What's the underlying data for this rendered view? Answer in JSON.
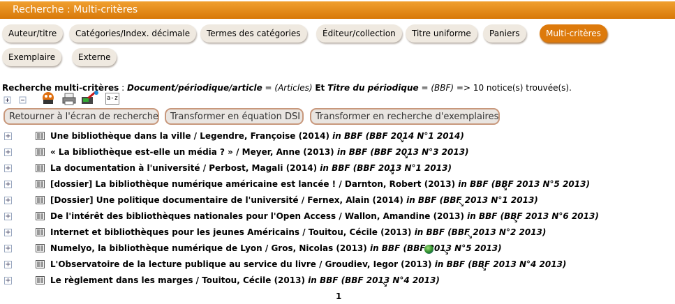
{
  "header": {
    "title": "Recherche : Multi-critères"
  },
  "tabs": [
    {
      "label": "Auteur/titre"
    },
    {
      "label": "Catégories/Index. décimale"
    },
    {
      "label": "Termes des catégories"
    },
    {
      "label": "Éditeur/collection"
    },
    {
      "label": "Titre uniforme"
    },
    {
      "label": "Paniers"
    },
    {
      "label": "Multi-critères",
      "active": true
    },
    {
      "label": "Exemplaire"
    },
    {
      "label": "Externe"
    }
  ],
  "summary": {
    "intro": "Recherche multi-critères",
    "colon": " : ",
    "field1": "Document/périodique/article",
    "eq1": " = (Articles) ",
    "and": "Et",
    "field2": "Titre du périodique",
    "eq2": " = (BBF)",
    "result": " => 10 notice(s) trouvée(s)."
  },
  "toolbar": {
    "sort_label": "a-z"
  },
  "actions": {
    "back": "Retourner à l'écran de recherche",
    "dsi": "Transformer en équation DSI",
    "copies": "Transformer en recherche d'exemplaires"
  },
  "results": [
    {
      "title": "Une bibliothèque dans la ville / Legendre, Françoise (2014)",
      "source": "in BBF (BBF 2014 N°1 2014)"
    },
    {
      "title": "« La bibliothèque est-elle un média ? » / Meyer, Anne (2013)",
      "source": "in BBF (BBF 2013 N°3 2013)"
    },
    {
      "title": "La documentation à l'université / Perbost, Magali (2014)",
      "source": "in BBF (BBF 2013 N°1 2013)"
    },
    {
      "title": "[dossier] La bibliothèque numérique américaine est lancée ! / Darnton, Robert (2013)",
      "source": "in BBF (BBF 2013 N°5 2013)"
    },
    {
      "title": "[Dossier] Une politique documentaire de l'université / Fernex, Alain (2014)",
      "source": "in BBF (BBF 2013 N°1 2013)"
    },
    {
      "title": "De l'intérêt des bibliothèques nationales pour l'Open Access / Wallon, Amandine (2013)",
      "source": "in BBF (BBF 2013 N°6 2013)"
    },
    {
      "title": "Internet et bibliothèques pour les jeunes Américains / Touitou, Cécile (2013)",
      "source": "in BBF (BBF 2013 N°2 2013)"
    },
    {
      "title": "Numelyo, la bibliothèque numérique de Lyon / Gros, Nicolas (2013)",
      "source": "in BBF (BBF 2013 N°5 2013)",
      "globe": true
    },
    {
      "title": "L'Observatoire de la lecture publique au service du livre / Groudiev, Iegor (2013)",
      "source": "in BBF (BBF 2013 N°4 2013)"
    },
    {
      "title": "Le règlement dans les marges / Touitou, Cécile (2013)",
      "source": "in BBF (BBF 2013 N°4 2013)"
    }
  ],
  "pagination": {
    "current": "1"
  },
  "colors": {
    "header": "#e8901c",
    "active_tab": "#dd7a0c",
    "button_border": "#c8987c"
  }
}
